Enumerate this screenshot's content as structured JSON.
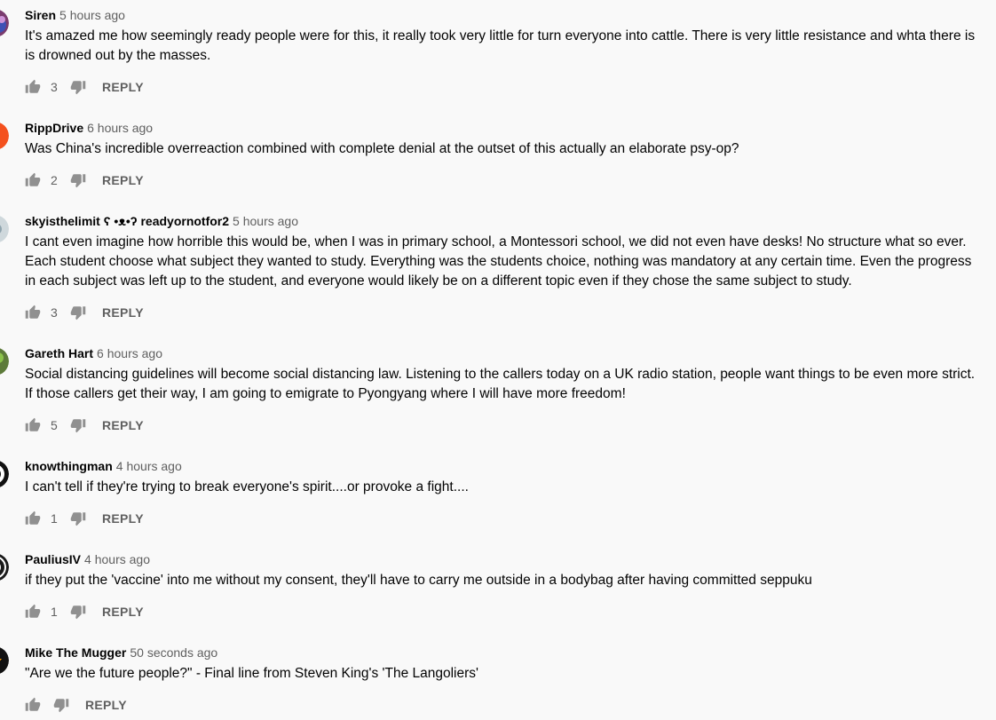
{
  "comments": [
    {
      "author": "Siren",
      "time": "5 hours ago",
      "text": "It's amazed me how seemingly ready people were for this, it really took very little for turn everyone into cattle.  There is very little resistance and whta there is is drowned out by the masses.",
      "likes": "3",
      "reply_label": "REPLY",
      "avatar_color": "#7a3b6e"
    },
    {
      "author": "RippDrive",
      "time": "6 hours ago",
      "text": "Was China's incredible overreaction combined with complete denial at the outset of this actually an elaborate psy-op?",
      "likes": "2",
      "reply_label": "REPLY",
      "avatar_color": "#f4511e"
    },
    {
      "author": "skyisthelimit ʕ •ᴥ•ʔ readyornotfor2",
      "time": "5 hours ago",
      "text": "I cant even imagine how horrible this would be, when I was in primary school, a Montessori school, we did not even have desks! No structure what so ever. Each student choose what subject they wanted to study. Everything was the students choice, nothing was mandatory at any certain time. Even the progress in each subject was left up to the student, and everyone would likely be on a different topic even if they chose the same subject to study.",
      "likes": "3",
      "reply_label": "REPLY",
      "avatar_color": "#cfd8dc"
    },
    {
      "author": "Gareth Hart",
      "time": "6 hours ago",
      "text": "Social distancing guidelines will become social distancing law. Listening to the callers today on a UK radio station, people want things to be even more strict. If those callers get their way, I am going to emigrate to Pyongyang where I will have more freedom!",
      "likes": "5",
      "reply_label": "REPLY",
      "avatar_color": "#5d7b3a"
    },
    {
      "author": "knowthingman",
      "time": "4 hours ago",
      "text": "I can't tell if they're trying to break everyone's spirit....or provoke a fight....",
      "likes": "1",
      "reply_label": "REPLY",
      "avatar_color": "#111111"
    },
    {
      "author": "PauliusIV",
      "time": "4 hours ago",
      "text": "if they put the 'vaccine' into me without my consent, they'll have to carry me outside in a bodybag after having committed seppuku",
      "likes": "1",
      "reply_label": "REPLY",
      "avatar_color": "#1a1a1a"
    },
    {
      "author": "Mike The Mugger",
      "time": "50 seconds ago",
      "text": "\"Are we the future people?\" - Final line from Steven King's 'The Langoliers'",
      "likes": "",
      "reply_label": "REPLY",
      "avatar_color": "#e65100"
    }
  ],
  "icons": {
    "like": "thumb-up-icon",
    "dislike": "thumb-down-icon"
  },
  "colors": {
    "background": "#f9f9f9",
    "author": "#030303",
    "meta": "#606060"
  }
}
